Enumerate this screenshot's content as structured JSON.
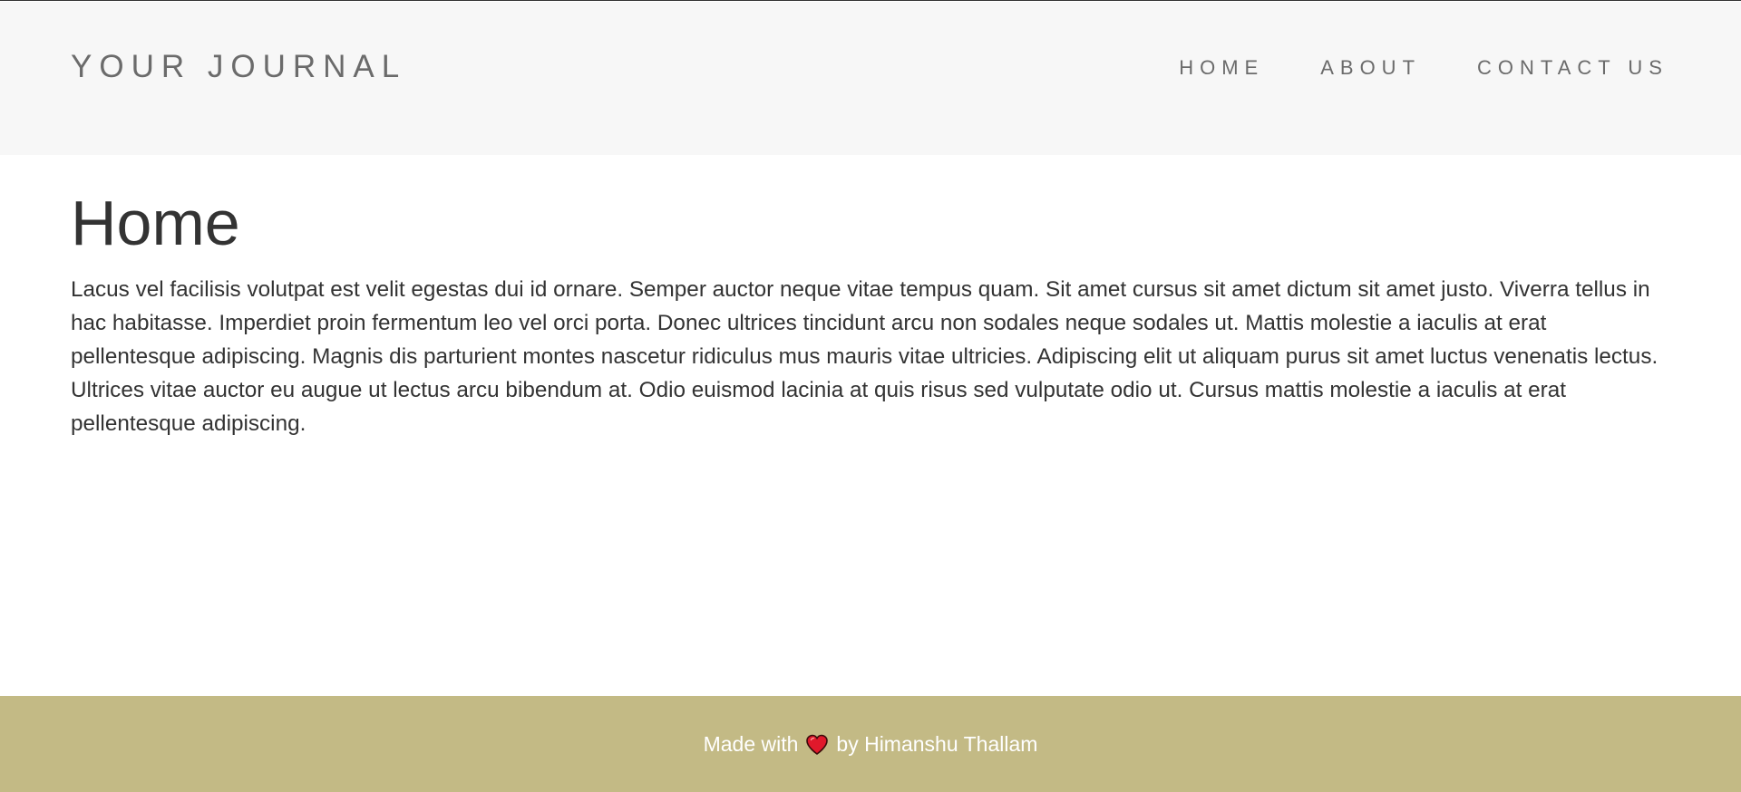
{
  "header": {
    "brand": "YOUR JOURNAL",
    "nav": [
      {
        "label": "HOME"
      },
      {
        "label": "ABOUT"
      },
      {
        "label": "CONTACT US"
      }
    ]
  },
  "main": {
    "title": "Home",
    "body": "Lacus vel facilisis volutpat est velit egestas dui id ornare. Semper auctor neque vitae tempus quam. Sit amet cursus sit amet dictum sit amet justo. Viverra tellus in hac habitasse. Imperdiet proin fermentum leo vel orci porta. Donec ultrices tincidunt arcu non sodales neque sodales ut. Mattis molestie a iaculis at erat pellentesque adipiscing. Magnis dis parturient montes nascetur ridiculus mus mauris vitae ultricies. Adipiscing elit ut aliquam purus sit amet luctus venenatis lectus. Ultrices vitae auctor eu augue ut lectus arcu bibendum at. Odio euismod lacinia at quis risus sed vulputate odio ut. Cursus mattis molestie a iaculis at erat pellentesque adipiscing."
  },
  "footer": {
    "prefix": "Made with",
    "icon": "heart-icon",
    "suffix": "by Himanshu Thallam"
  },
  "colors": {
    "header_bg": "#f7f7f7",
    "footer_bg": "#c3ba85",
    "text": "#333333",
    "nav_text": "#6b6b6b",
    "heart": "#e0192b"
  }
}
